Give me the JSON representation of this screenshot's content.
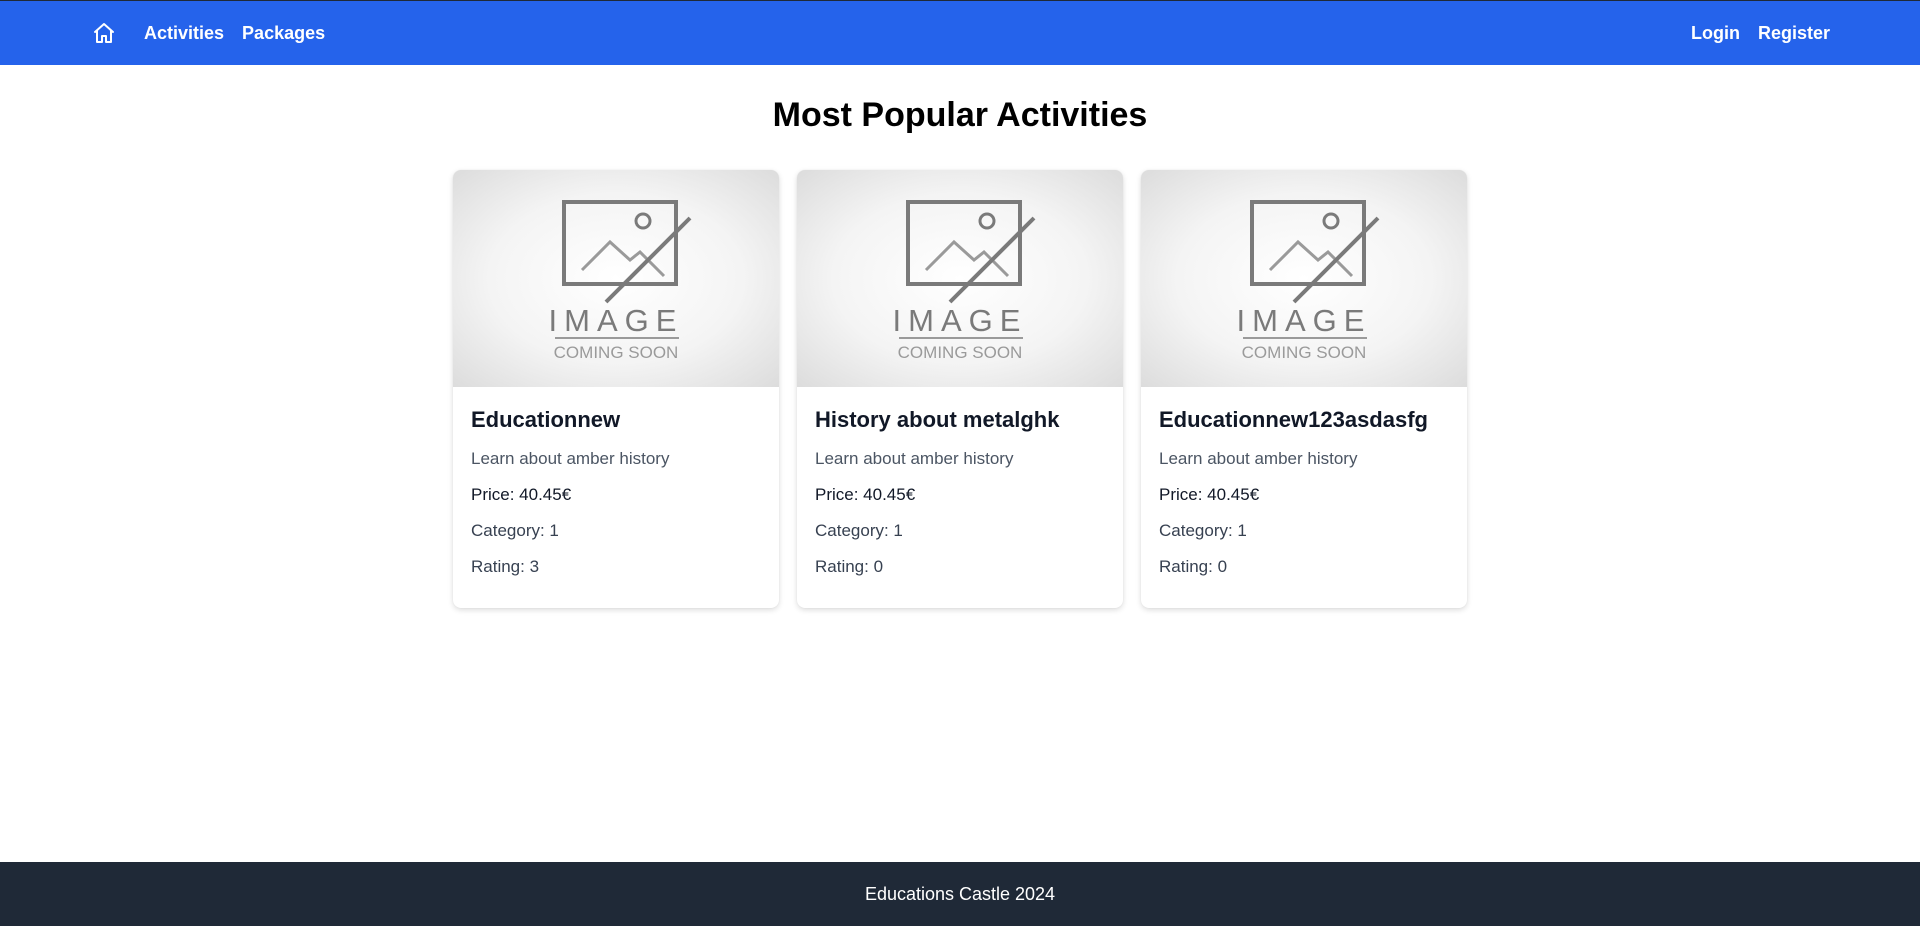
{
  "nav": {
    "home_icon": "home-icon",
    "left_links": [
      "Activities",
      "Packages"
    ],
    "right_links": [
      "Login",
      "Register"
    ]
  },
  "main": {
    "heading": "Most Popular Activities",
    "placeholder_image": {
      "icon": "image-placeholder-icon",
      "line1": "IMAGE",
      "line2": "COMING SOON"
    },
    "cards": [
      {
        "title": "Educationnew",
        "description": "Learn about amber history",
        "price": "Price: 40.45€",
        "category": "Category: 1",
        "rating": "Rating: 3"
      },
      {
        "title": "History about metalghk",
        "description": "Learn about amber history",
        "price": "Price: 40.45€",
        "category": "Category: 1",
        "rating": "Rating: 0"
      },
      {
        "title": "Educationnew123asdasfg",
        "description": "Learn about amber history",
        "price": "Price: 40.45€",
        "category": "Category: 1",
        "rating": "Rating: 0"
      }
    ]
  },
  "footer": {
    "text": "Educations Castle 2024"
  },
  "colors": {
    "nav_bg": "#2563eb",
    "footer_bg": "#1f2937",
    "text": "#111827",
    "muted": "#4b5563"
  }
}
